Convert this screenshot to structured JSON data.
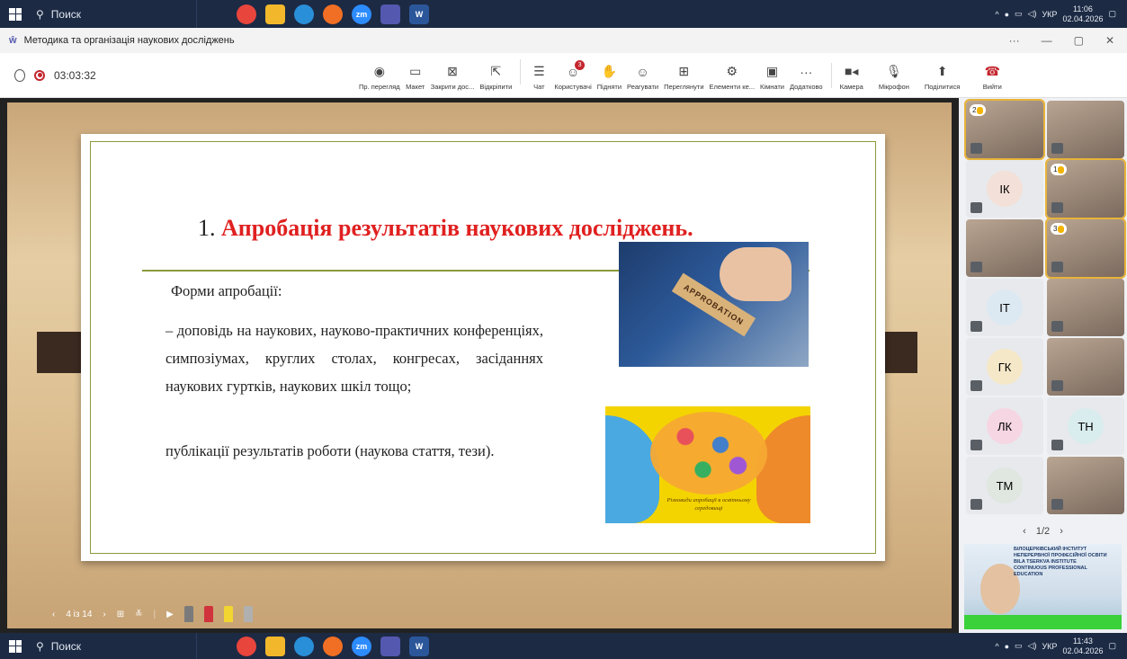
{
  "taskbar_top": {
    "search_placeholder": "Поиск",
    "lang": "УКР",
    "time": "11:06",
    "date": "02.04.2026"
  },
  "taskbar_bottom": {
    "search_placeholder": "Поиск",
    "lang": "УКР",
    "time": "11:43",
    "date": "02.04.2026"
  },
  "window": {
    "title": "Методика та організація наукових досліджень",
    "more": "···",
    "minimize": "—",
    "restore": "▢",
    "close": "✕"
  },
  "meeting": {
    "timer": "03:03:32",
    "tools": [
      {
        "label": "Пр. перегляд",
        "icon": "eye-icon",
        "glyph": "◉"
      },
      {
        "label": "Макет",
        "icon": "layout-icon",
        "glyph": "▭"
      },
      {
        "label": "Закрити дос...",
        "icon": "close-share-icon",
        "glyph": "⊠"
      },
      {
        "label": "Відкріпити",
        "icon": "unpin-icon",
        "glyph": "⇱"
      },
      {
        "label": "Чат",
        "icon": "chat-icon",
        "glyph": "☰"
      },
      {
        "label": "Користувачі",
        "icon": "users-icon",
        "glyph": "☺",
        "badge": "3"
      },
      {
        "label": "Підняти",
        "icon": "raise-hand-icon",
        "glyph": "✋"
      },
      {
        "label": "Реагувати",
        "icon": "react-icon",
        "glyph": "☺"
      },
      {
        "label": "Переглянути",
        "icon": "view-icon",
        "glyph": "⊞"
      },
      {
        "label": "Елементи ке...",
        "icon": "controls-icon",
        "glyph": "⚙"
      },
      {
        "label": "Кімнати",
        "icon": "rooms-icon",
        "glyph": "▣"
      },
      {
        "label": "Додатково",
        "icon": "more-icon",
        "glyph": "···"
      }
    ],
    "camera_label": "Камера",
    "mic_label": "Мікрофон",
    "share_label": "Поділитися",
    "leave_label": "Вийти"
  },
  "slide": {
    "title_number": "1.",
    "title_text": "Апробація результатів наукових досліджень",
    "title_end": ".",
    "forms_label": "Форми апробації:",
    "bullet1": "– доповідь на наукових, науково-практичних конференціях, симпозіумах, круглих столах, конгресах, засіданнях наукових гуртків, наукових шкіл тощо;",
    "bullet2": "публікації результатів роботи (наукова стаття, тези).",
    "image1_stamp": "APPROBATION",
    "image2_caption": "Різновиди апробації в освітньому середовищі"
  },
  "slide_nav": {
    "counter": "4 із 14",
    "prev": "‹",
    "next": "›"
  },
  "participants": {
    "tiles": [
      {
        "type": "video",
        "hand": "2"
      },
      {
        "type": "video"
      },
      {
        "type": "avatar",
        "initials": "ІК",
        "color": "#f3e0d8"
      },
      {
        "type": "video",
        "hand": "1"
      },
      {
        "type": "video"
      },
      {
        "type": "video",
        "hand": "3"
      },
      {
        "type": "avatar",
        "initials": "ІТ",
        "color": "#dde9f2"
      },
      {
        "type": "video"
      },
      {
        "type": "avatar",
        "initials": "ГК",
        "color": "#f5e8c9"
      },
      {
        "type": "video"
      },
      {
        "type": "avatar",
        "initials": "ЛК",
        "color": "#f6d6e3"
      },
      {
        "type": "avatar",
        "initials": "ТН",
        "color": "#d9ecee"
      },
      {
        "type": "avatar",
        "initials": "ТМ",
        "color": "#dfe7e0"
      },
      {
        "type": "video"
      }
    ],
    "pager": "1/2",
    "speaker_text_1": "БІЛОЦЕРКІВСЬКИЙ ІНСТИТУТ",
    "speaker_text_2": "НЕПЕРЕРВНОЇ ПРОФЕСІЙНОЇ ОСВІТИ",
    "speaker_text_3": "BILA TSERKVA INSTITUTE",
    "speaker_text_4": "CONTINUOUS PROFESSIONAL",
    "speaker_text_5": "EDUCATION"
  },
  "colors": {
    "title_red": "#e02020",
    "frame_green": "#8a9a3c",
    "taskbar": "#1c2a44"
  }
}
